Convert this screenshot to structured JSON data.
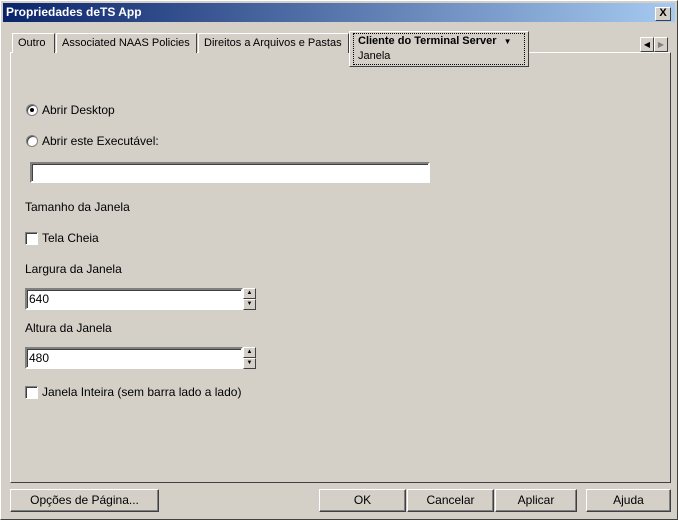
{
  "window": {
    "title": "Propriedades deTS App",
    "close_label": "X"
  },
  "tabs": [
    {
      "label": "Outro"
    },
    {
      "label": "Associated NAAS Policies"
    },
    {
      "label": "Direitos a Arquivos e Pastas"
    },
    {
      "label": "Cliente do Terminal Server",
      "dropdown": "▼",
      "subtab": "Janela"
    }
  ],
  "tab_scroll": {
    "left": "◀",
    "right": "▶"
  },
  "form": {
    "radio_desktop": {
      "label": "Abrir Desktop",
      "checked": true
    },
    "radio_exe": {
      "label": "Abrir este Executável:",
      "checked": false
    },
    "exe_path": "",
    "size_heading": "Tamanho da Janela",
    "fullscreen": {
      "label": "Tela Cheia",
      "checked": false
    },
    "width_label": "Largura da Janela",
    "width_value": "640",
    "height_label": "Altura da Janela",
    "height_value": "480",
    "full_window": {
      "label": "Janela Inteira (sem barra lado a lado)",
      "checked": false
    },
    "spin_up": "▲",
    "spin_down": "▼"
  },
  "buttons": {
    "page_options": "Opções de Página...",
    "ok": "OK",
    "cancel": "Cancelar",
    "apply": "Aplicar",
    "help": "Ajuda"
  }
}
